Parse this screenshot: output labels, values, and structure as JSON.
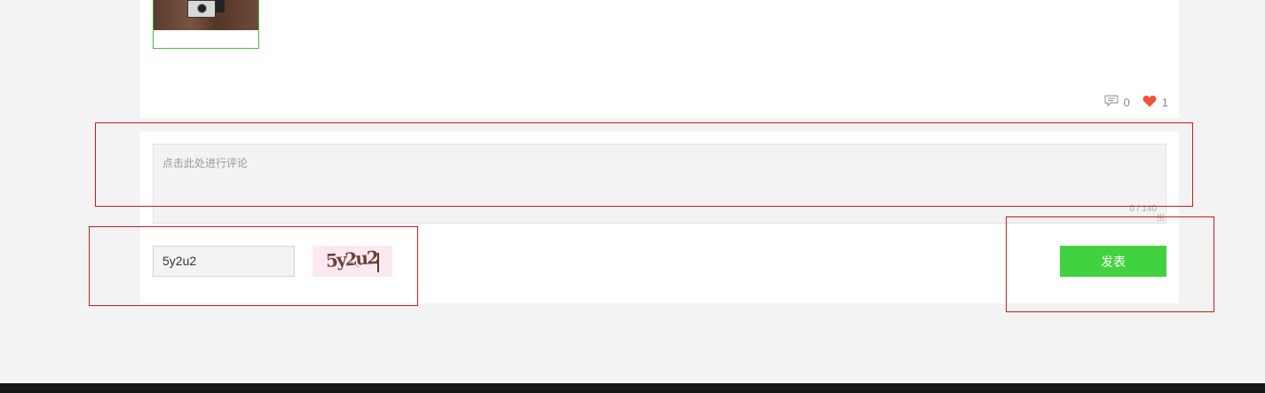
{
  "post": {
    "comment_count": "0",
    "like_count": "1",
    "icons": {
      "comment": "comment-icon",
      "like": "heart-icon"
    }
  },
  "comment_form": {
    "placeholder": "点击此处进行评论",
    "char_counter": "0 / 140",
    "captcha_value": "5y2u2",
    "captcha_image_text": "5y2u2",
    "submit_label": "发表"
  },
  "colors": {
    "accent_green": "#43d23f",
    "like_red": "#f0553a",
    "highlight_red": "#cc1b1b"
  }
}
